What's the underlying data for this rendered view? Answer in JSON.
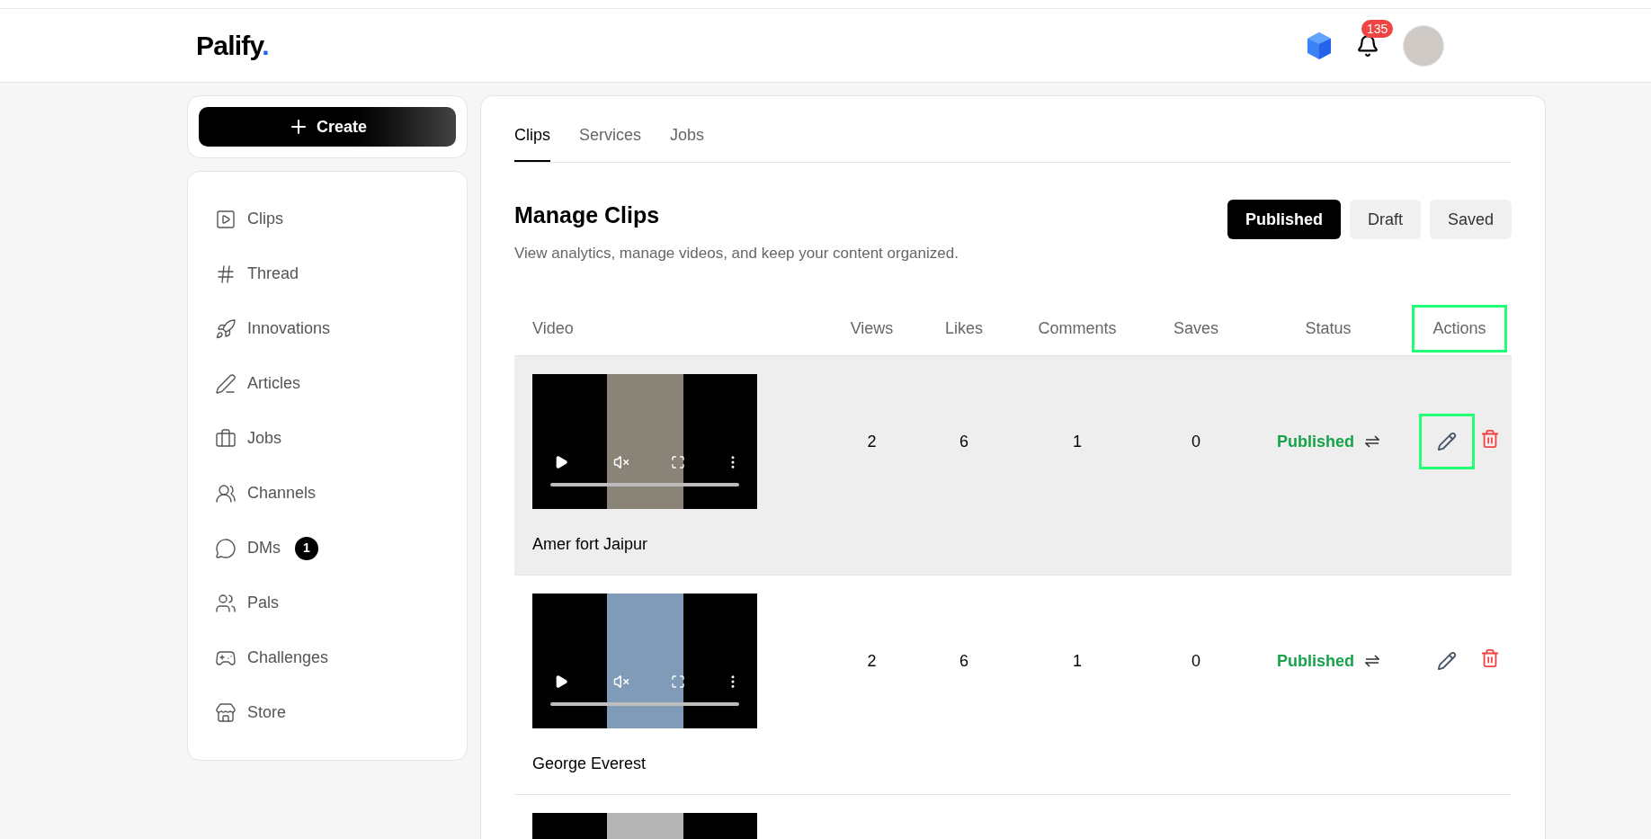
{
  "header": {
    "logo": "Palify",
    "logo_dot": ".",
    "notifications": "135"
  },
  "create_button": "Create",
  "sidebar": {
    "items": [
      {
        "label": "Clips"
      },
      {
        "label": "Thread"
      },
      {
        "label": "Innovations"
      },
      {
        "label": "Articles"
      },
      {
        "label": "Jobs"
      },
      {
        "label": "Channels"
      },
      {
        "label": "DMs",
        "badge": "1"
      },
      {
        "label": "Pals"
      },
      {
        "label": "Challenges"
      },
      {
        "label": "Store"
      }
    ]
  },
  "tabs": [
    {
      "label": "Clips",
      "selected": true
    },
    {
      "label": "Services",
      "selected": false
    },
    {
      "label": "Jobs",
      "selected": false
    }
  ],
  "title": "Manage Clips",
  "subtitle": "View analytics, manage videos, and keep your content organized.",
  "filters": [
    {
      "label": "Published",
      "selected": true
    },
    {
      "label": "Draft",
      "selected": false
    },
    {
      "label": "Saved",
      "selected": false
    }
  ],
  "table": {
    "columns": [
      {
        "label": "Video",
        "highlighted": false
      },
      {
        "label": "Views",
        "highlighted": false
      },
      {
        "label": "Likes",
        "highlighted": false
      },
      {
        "label": "Comments",
        "highlighted": false
      },
      {
        "label": "Saves",
        "highlighted": false
      },
      {
        "label": "Status",
        "highlighted": false
      },
      {
        "label": "Actions",
        "highlighted": true
      }
    ],
    "rows": [
      {
        "kind": "full",
        "title": "Amer fort Jaipur",
        "views": "2",
        "likes": "6",
        "comments": "1",
        "saves": "0",
        "status": "Published",
        "hovered": true,
        "edit_highlighted": true
      },
      {
        "kind": "full",
        "title": "George Everest",
        "views": "2",
        "likes": "6",
        "comments": "1",
        "saves": "0",
        "status": "Published",
        "hovered": false,
        "edit_highlighted": false
      },
      {
        "kind": "cut"
      }
    ]
  }
}
